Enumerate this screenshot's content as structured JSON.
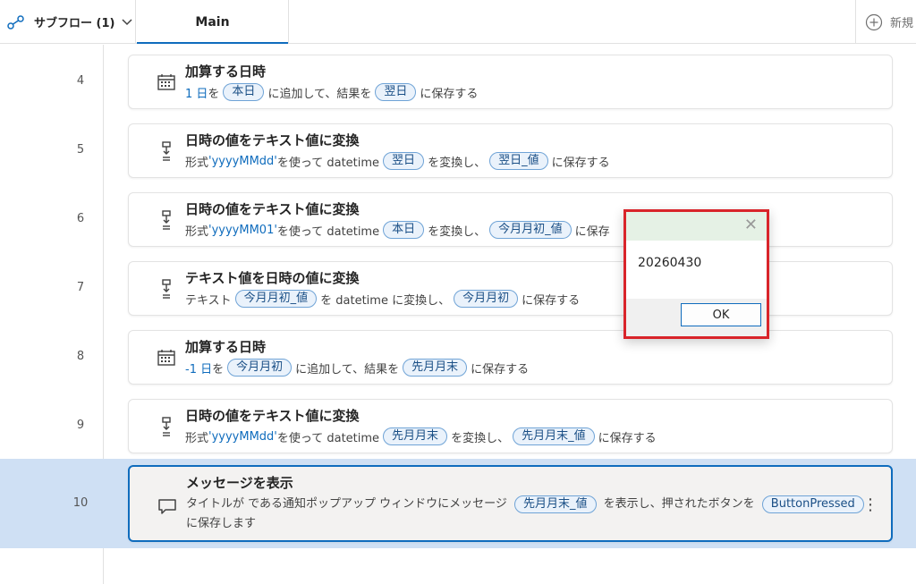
{
  "topbar": {
    "subflow_label": "サブフロー (1)",
    "tab_main": "Main",
    "new_label": "新規"
  },
  "rows": [
    {
      "num": "4",
      "title": "加算する日時",
      "desc": [
        {
          "t": "text",
          "v": "1 日",
          "blue": true
        },
        {
          "t": "text",
          "v": " を "
        },
        {
          "t": "pill",
          "v": "本日"
        },
        {
          "t": "text",
          "v": " に追加して、結果を "
        },
        {
          "t": "pill",
          "v": "翌日"
        },
        {
          "t": "text",
          "v": " に保存する"
        }
      ]
    },
    {
      "num": "5",
      "title": "日時の値をテキスト値に変換",
      "desc": [
        {
          "t": "text",
          "v": "形式 "
        },
        {
          "t": "text",
          "v": "'yyyyMMdd'",
          "blue": true
        },
        {
          "t": "text",
          "v": " を使って datetime "
        },
        {
          "t": "pill",
          "v": "翌日"
        },
        {
          "t": "text",
          "v": " を変換し、"
        },
        {
          "t": "pill",
          "v": "翌日_値"
        },
        {
          "t": "text",
          "v": " に保存する"
        }
      ]
    },
    {
      "num": "6",
      "title": "日時の値をテキスト値に変換",
      "desc": [
        {
          "t": "text",
          "v": "形式 "
        },
        {
          "t": "text",
          "v": "'yyyyMM01'",
          "blue": true
        },
        {
          "t": "text",
          "v": " を使って datetime "
        },
        {
          "t": "pill",
          "v": "本日"
        },
        {
          "t": "text",
          "v": " を変換し、"
        },
        {
          "t": "pill",
          "v": "今月月初_値"
        },
        {
          "t": "text",
          "v": " に保存"
        }
      ]
    },
    {
      "num": "7",
      "title": "テキスト値を日時の値に変換",
      "desc": [
        {
          "t": "text",
          "v": "テキスト "
        },
        {
          "t": "pill",
          "v": "今月月初_値"
        },
        {
          "t": "text",
          "v": " を datetime に変換し、"
        },
        {
          "t": "pill",
          "v": "今月月初"
        },
        {
          "t": "text",
          "v": " に保存する"
        }
      ]
    },
    {
      "num": "8",
      "title": "加算する日時",
      "desc": [
        {
          "t": "text",
          "v": "-1 日",
          "blue": true
        },
        {
          "t": "text",
          "v": " を "
        },
        {
          "t": "pill",
          "v": "今月月初"
        },
        {
          "t": "text",
          "v": " に追加して、結果を "
        },
        {
          "t": "pill",
          "v": "先月月末"
        },
        {
          "t": "text",
          "v": " に保存する"
        }
      ]
    },
    {
      "num": "9",
      "title": "日時の値をテキスト値に変換",
      "desc": [
        {
          "t": "text",
          "v": "形式 "
        },
        {
          "t": "text",
          "v": "'yyyyMMdd'",
          "blue": true
        },
        {
          "t": "text",
          "v": " を使って datetime "
        },
        {
          "t": "pill",
          "v": "先月月末"
        },
        {
          "t": "text",
          "v": " を変換し、"
        },
        {
          "t": "pill",
          "v": "先月月末_値"
        },
        {
          "t": "text",
          "v": " に保存する"
        }
      ]
    }
  ],
  "selected": {
    "num": "10",
    "title": "メッセージを表示",
    "desc": [
      {
        "t": "text",
        "v": "タイトルが  である通知ポップアップ ウィンドウにメッセージ "
      },
      {
        "t": "pill",
        "v": "先月月末_値"
      },
      {
        "t": "text",
        "v": " を表示し、押されたボタンを "
      },
      {
        "t": "pill",
        "v": "ButtonPressed"
      },
      {
        "t": "text",
        "v": " に保存します"
      }
    ]
  },
  "popup": {
    "message": "20260430",
    "ok_label": "OK"
  },
  "icons": {
    "row_4": "calendar-icon",
    "row_5": "convert-icon",
    "row_6": "convert-icon",
    "row_7": "convert-icon",
    "row_8": "calendar-icon",
    "row_9": "convert-icon",
    "row_10": "message-icon"
  },
  "colors": {
    "accent": "#0f6cbd",
    "selected_row": "#cfe0f4",
    "popup_border": "#d9242a",
    "popup_header": "#e5f1e5"
  }
}
